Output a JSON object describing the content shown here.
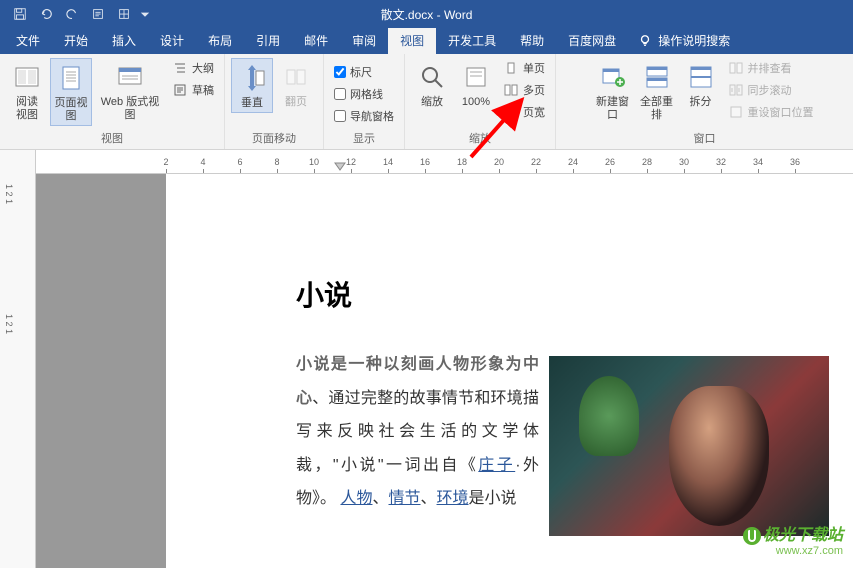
{
  "title": "散文.docx - Word",
  "tabs": {
    "file": "文件",
    "start": "开始",
    "insert": "插入",
    "design": "设计",
    "layout": "布局",
    "references": "引用",
    "mail": "邮件",
    "review": "审阅",
    "view": "视图",
    "dev": "开发工具",
    "help": "帮助",
    "baidu": "百度网盘",
    "tellme": "操作说明搜索"
  },
  "ribbon": {
    "views": {
      "label": "视图",
      "read": "阅读\n视图",
      "page": "页面视图",
      "web": "Web 版式视图",
      "outline": "大纲",
      "draft": "草稿"
    },
    "pagemove": {
      "label": "页面移动",
      "vertical": "垂直",
      "flip": "翻页"
    },
    "show": {
      "label": "显示",
      "ruler": "标尺",
      "gridlines": "网格线",
      "navpane": "导航窗格"
    },
    "zoom": {
      "label": "缩放",
      "zoom": "缩放",
      "pct": "100%",
      "onepage": "单页",
      "multipage": "多页",
      "pagewidth": "页宽"
    },
    "window": {
      "label": "窗口",
      "new": "新建窗口",
      "arrange": "全部重排",
      "split": "拆分",
      "sidebyside": "并排查看",
      "syncscroll": "同步滚动",
      "resetpos": "重设窗口位置"
    }
  },
  "ruler_nums": [
    2,
    4,
    6,
    8,
    10,
    12,
    14,
    16,
    18,
    20,
    22,
    24,
    26,
    28,
    30,
    32,
    34,
    36
  ],
  "doc": {
    "heading": "小说",
    "lead": "小说是一种以刻画人物形象为中心",
    "body1": "、通过完整的故事情节和环境描写来反映社会生活的文学体裁，\"小说\"一词出自《",
    "link1": "庄子",
    "body2": "·外物》。",
    "link2": "人物",
    "sep1": "、",
    "link3": "情节",
    "sep2": "、",
    "link4": "环境",
    "body3": "是小说"
  },
  "watermark": {
    "line1": "极光下载站",
    "line2": "www.xz7.com"
  }
}
